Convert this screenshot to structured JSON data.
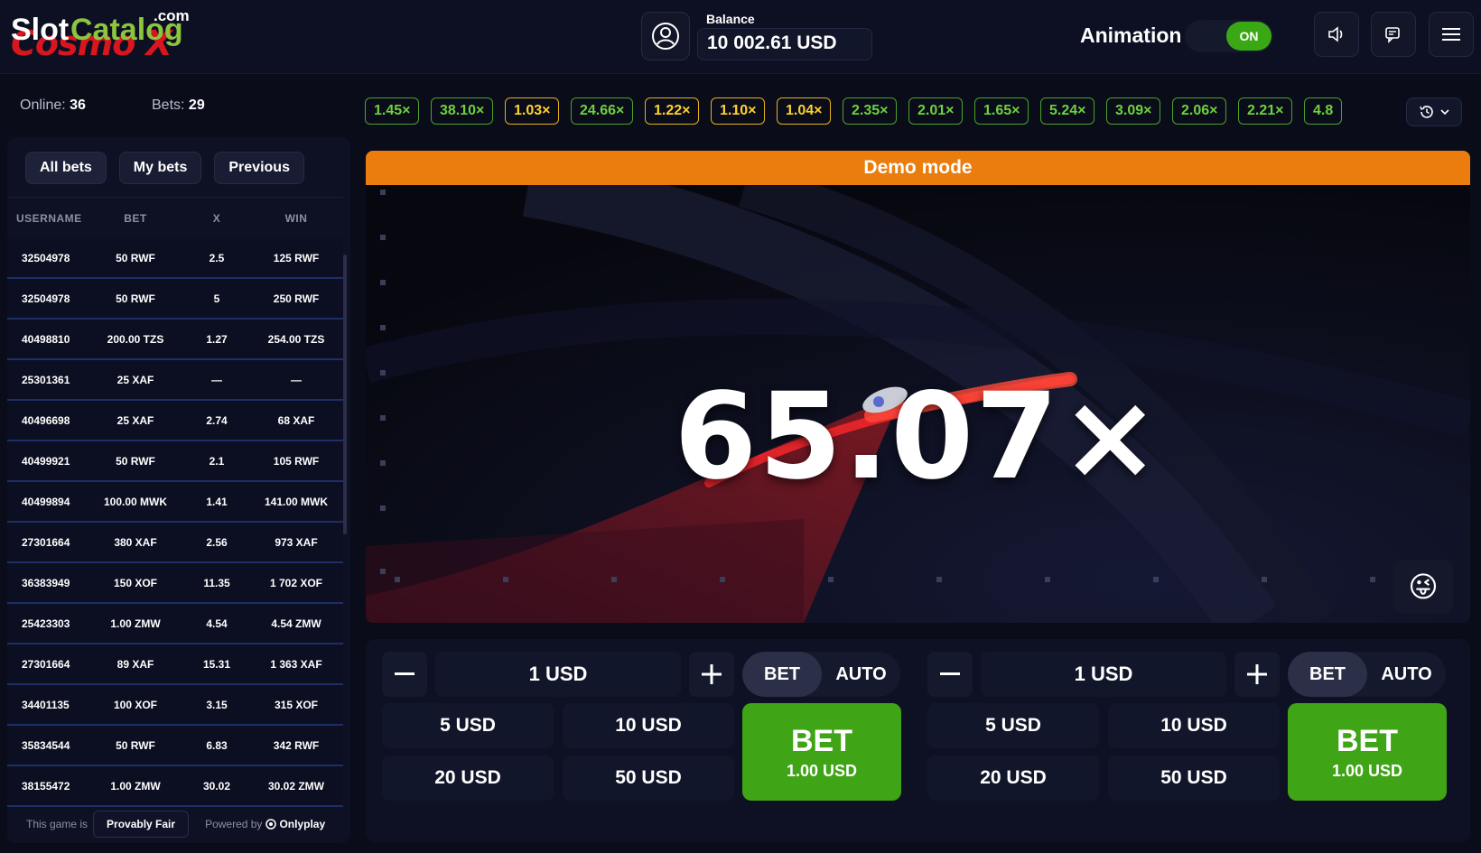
{
  "header": {
    "logo": {
      "slot": "Slot",
      "catalog": "Catalog",
      "com": ".com",
      "cosmo": "Cosmo X"
    },
    "balance_label": "Balance",
    "balance_value": "10 002.61 USD",
    "animation_label": "Animation",
    "animation_toggle": "ON",
    "icons": [
      "user-icon",
      "speaker-icon",
      "chat-icon",
      "menu-icon"
    ]
  },
  "stats": {
    "online_label": "Online:",
    "online_value": "36",
    "bets_label": "Bets:",
    "bets_value": "29"
  },
  "bets_panel": {
    "tabs": [
      "All bets",
      "My bets",
      "Previous"
    ],
    "columns": [
      "USERNAME",
      "BET",
      "X",
      "WIN"
    ],
    "rows": [
      [
        "32504978",
        "50 RWF",
        "2.5",
        "125 RWF"
      ],
      [
        "32504978",
        "50 RWF",
        "5",
        "250 RWF"
      ],
      [
        "40498810",
        "200.00 TZS",
        "1.27",
        "254.00 TZS"
      ],
      [
        "25301361",
        "25 XAF",
        "—",
        "—"
      ],
      [
        "40496698",
        "25 XAF",
        "2.74",
        "68 XAF"
      ],
      [
        "40499921",
        "50 RWF",
        "2.1",
        "105 RWF"
      ],
      [
        "40499894",
        "100.00 MWK",
        "1.41",
        "141.00 MWK"
      ],
      [
        "27301664",
        "380 XAF",
        "2.56",
        "973 XAF"
      ],
      [
        "36383949",
        "150 XOF",
        "11.35",
        "1 702 XOF"
      ],
      [
        "25423303",
        "1.00 ZMW",
        "4.54",
        "4.54 ZMW"
      ],
      [
        "27301664",
        "89 XAF",
        "15.31",
        "1 363 XAF"
      ],
      [
        "34401135",
        "100 XOF",
        "3.15",
        "315 XOF"
      ],
      [
        "35834544",
        "50 RWF",
        "6.83",
        "342 RWF"
      ],
      [
        "38155472",
        "1.00 ZMW",
        "30.02",
        "30.02 ZMW"
      ]
    ],
    "footer": {
      "prefix": "This game is",
      "provably_fair": "Provably Fair",
      "powered_by": "Powered by",
      "provider": "Onlyplay"
    }
  },
  "history": [
    {
      "value": "1.45×",
      "color": "green"
    },
    {
      "value": "38.10×",
      "color": "green"
    },
    {
      "value": "1.03×",
      "color": "yellow"
    },
    {
      "value": "24.66×",
      "color": "green"
    },
    {
      "value": "1.22×",
      "color": "yellow"
    },
    {
      "value": "1.10×",
      "color": "yellow"
    },
    {
      "value": "1.04×",
      "color": "yellow"
    },
    {
      "value": "2.35×",
      "color": "green"
    },
    {
      "value": "2.01×",
      "color": "green"
    },
    {
      "value": "1.65×",
      "color": "green"
    },
    {
      "value": "5.24×",
      "color": "green"
    },
    {
      "value": "3.09×",
      "color": "green"
    },
    {
      "value": "2.06×",
      "color": "green"
    },
    {
      "value": "2.21×",
      "color": "green"
    },
    {
      "value": "4.8",
      "color": "green"
    }
  ],
  "game": {
    "demo_label": "Demo mode",
    "multiplier": "65.07×",
    "emoji": "😜"
  },
  "bet_controls": [
    {
      "amount": "1 USD",
      "mode_bet": "BET",
      "mode_auto": "AUTO",
      "quick": [
        "5 USD",
        "10 USD",
        "20 USD",
        "50 USD"
      ],
      "bet_label": "BET",
      "bet_amount": "1.00 USD"
    },
    {
      "amount": "1 USD",
      "mode_bet": "BET",
      "mode_auto": "AUTO",
      "quick": [
        "5 USD",
        "10 USD",
        "20 USD",
        "50 USD"
      ],
      "bet_label": "BET",
      "bet_amount": "1.00 USD"
    }
  ],
  "colors": {
    "accent_green": "#3fa416",
    "demo_orange": "#ea7d0d",
    "chip_green": "#6fd13b",
    "chip_yellow": "#ffd22e"
  }
}
